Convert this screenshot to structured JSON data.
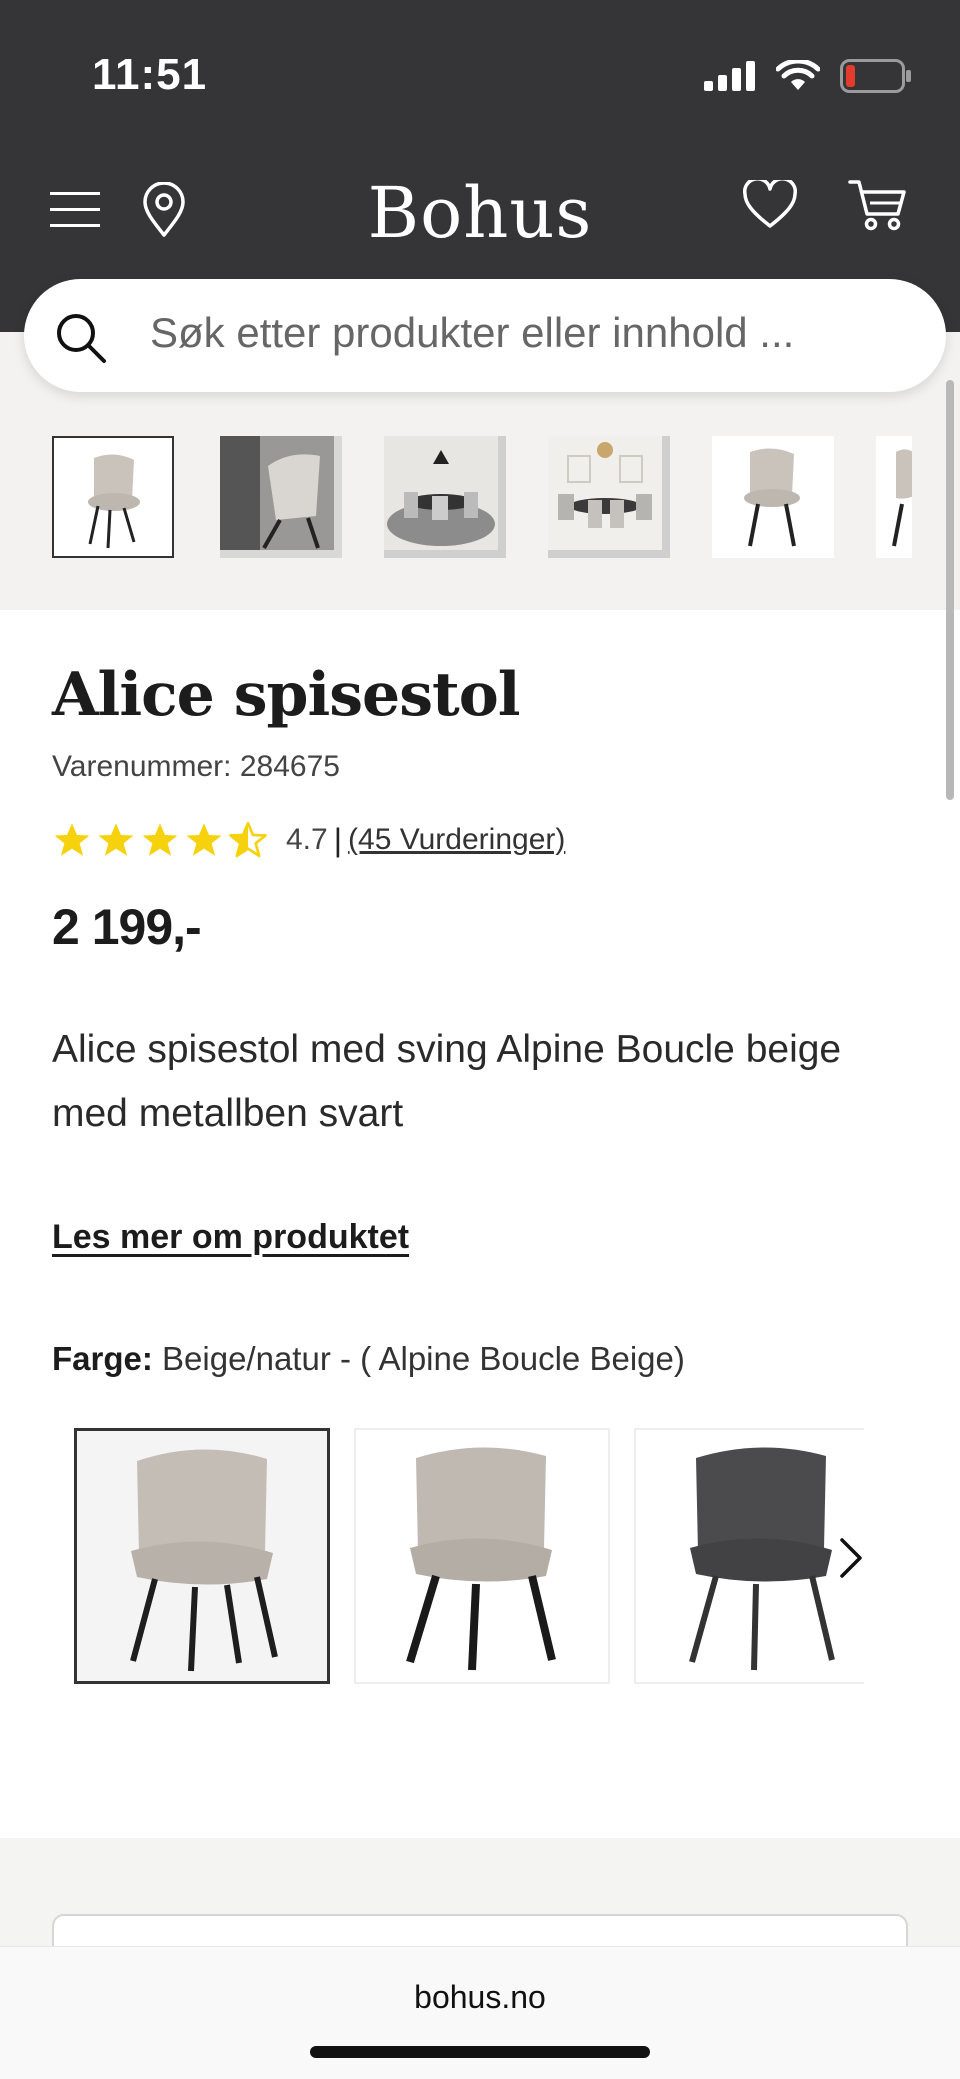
{
  "status_bar": {
    "time": "11:51"
  },
  "header": {
    "logo": "Bohus"
  },
  "search": {
    "placeholder": "Søk etter produkter eller innhold ..."
  },
  "product": {
    "title": "Alice spisestol",
    "sku": "Varenummer: 284675",
    "rating": {
      "score": "4.7",
      "separator": "|",
      "reviews": "(45 Vurderinger)",
      "stars_value": 4.7,
      "stars_max": 5
    },
    "price": "2 199,-",
    "description": "Alice spisestol med sving Alpine Boucle beige med metallben svart",
    "read_more": "Les mer om produktet",
    "color_label": "Farge:",
    "color_value": "Beige/natur - ( Alpine Boucle Beige)"
  },
  "colors": {
    "accent_star": "#f5d20d",
    "header_bg": "#353538"
  },
  "browser": {
    "url": "bohus.no"
  }
}
